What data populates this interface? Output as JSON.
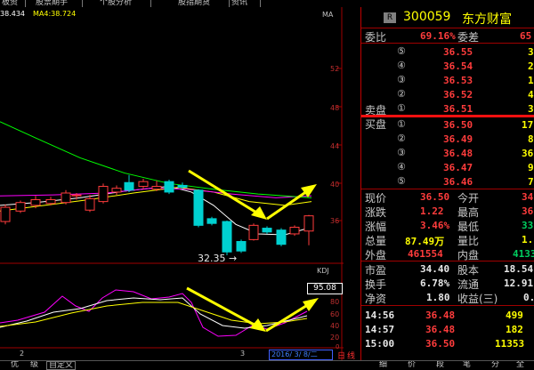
{
  "tabs": [
    "板资",
    "股票期手",
    "个股分析",
    "股指期货",
    "资讯"
  ],
  "chart": {
    "ma_label1": "38.434",
    "ma_label2": "MA4:38.724",
    "ma_corner": "MA",
    "y_ticks": [
      "52",
      "48",
      "44",
      "40",
      "36"
    ],
    "low_label": "32.35",
    "kdj_label": "KDJ",
    "kdj_value": "95.08",
    "kdj_ticks": [
      "80",
      "60",
      "40",
      "20",
      "0"
    ],
    "x_label_left": "2",
    "x_label_mid": "3",
    "date_label": "2016/ 3/ 8/二",
    "date_btn1": "日",
    "date_btn2": "线"
  },
  "colors": {
    "up": "#ff3c3c",
    "down": "#00d0d0",
    "ma1": "#ffffff",
    "ma2": "#ffff00",
    "ma3": "#ff00ff",
    "ma4": "#00ff00",
    "arrow": "#ffff00",
    "axis": "#a00000"
  },
  "stock": {
    "badge": "R",
    "code": "300059",
    "name": "东方财富"
  },
  "order_ratio": {
    "l1": "委比",
    "v1": "69.16%",
    "l2": "委差",
    "v2": "65"
  },
  "sell_label": "卖盘",
  "buy_label": "买盘",
  "sells": [
    {
      "n": "⑤",
      "price": "36.55",
      "vol": "3"
    },
    {
      "n": "④",
      "price": "36.54",
      "vol": "2"
    },
    {
      "n": "③",
      "price": "36.53",
      "vol": "1"
    },
    {
      "n": "②",
      "price": "36.52",
      "vol": "4"
    },
    {
      "n": "①",
      "price": "36.51",
      "vol": "3"
    }
  ],
  "buys": [
    {
      "n": "①",
      "price": "36.50",
      "vol": "17"
    },
    {
      "n": "②",
      "price": "36.49",
      "vol": "8"
    },
    {
      "n": "③",
      "price": "36.48",
      "vol": "36"
    },
    {
      "n": "④",
      "price": "36.47",
      "vol": "9"
    },
    {
      "n": "⑤",
      "price": "36.46",
      "vol": "7"
    }
  ],
  "quote": [
    {
      "l1": "现价",
      "v1": "36.50",
      "l2": "今开",
      "v2": "34."
    },
    {
      "l1": "涨跌",
      "v1": "1.22",
      "l2": "最高",
      "v2": "36."
    },
    {
      "l1": "涨幅",
      "v1": "3.46%",
      "l2": "最低",
      "v2": "33."
    },
    {
      "l1": "总量",
      "v1": "87.49万",
      "l2": "量比",
      "v2": "1."
    },
    {
      "l1": "外盘",
      "v1": "461554",
      "l2": "内盘",
      "v2": "4133"
    }
  ],
  "fundamentals": [
    {
      "l1": "市盈",
      "v1": "34.40",
      "l2": "股本",
      "v2": "18.54"
    },
    {
      "l1": "换手",
      "v1": "6.78%",
      "l2": "流通",
      "v2": "12.91"
    },
    {
      "l1": "净资",
      "v1": "1.80",
      "l2": "收益(三)",
      "v2": "0.7"
    }
  ],
  "ticks": [
    {
      "time": "14:56",
      "price": "36.48",
      "vol": "499"
    },
    {
      "time": "14:57",
      "price": "36.48",
      "vol": "182"
    },
    {
      "time": "15:00",
      "price": "36.50",
      "vol": "11353"
    }
  ],
  "bottom_tabs": [
    "优",
    "级",
    "自定义"
  ],
  "panel_bottom_tabs": [
    "细",
    "价",
    "段",
    "笔",
    "分",
    "全"
  ]
}
